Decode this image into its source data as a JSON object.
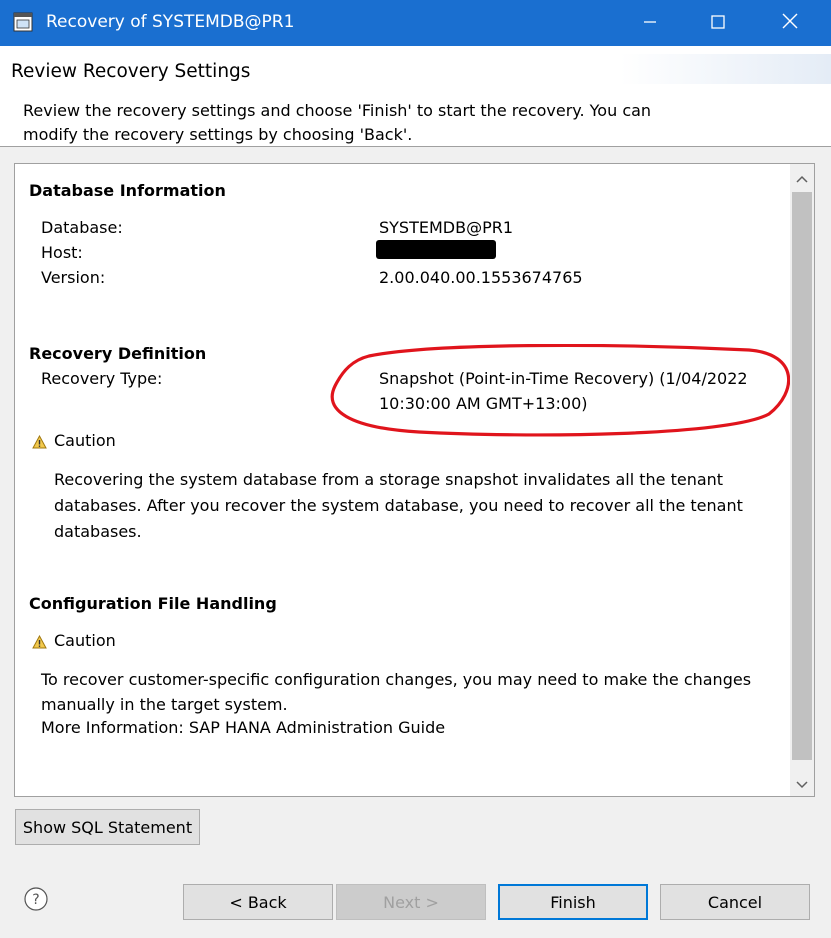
{
  "window": {
    "title": "Recovery of SYSTEMDB@PR1"
  },
  "header": {
    "title": "Review Recovery Settings",
    "description": "Review the recovery settings and choose 'Finish' to start the recovery. You can modify the recovery settings by choosing 'Back'."
  },
  "database_info": {
    "heading": "Database Information",
    "database_label": "Database:",
    "database_value": "SYSTEMDB@PR1",
    "host_label": "Host:",
    "host_value": "",
    "version_label": "Version:",
    "version_value": "2.00.040.00.1553674765"
  },
  "recovery_definition": {
    "heading": "Recovery Definition",
    "type_label": "Recovery Type:",
    "type_value_line1": "Snapshot (Point-in-Time Recovery) (1/04/2022",
    "type_value_line2": "10:30:00 AM GMT+13:00)",
    "caution_label": "Caution",
    "caution_text": "Recovering the system database from a storage snapshot invalidates all the tenant databases. After you recover the system database, you need to recover all the tenant databases."
  },
  "config_file_handling": {
    "heading": "Configuration File Handling",
    "caution_label": "Caution",
    "caution_text": "To recover customer-specific configuration changes, you may need to make the changes manually in the target system.",
    "more_info": "More Information: SAP HANA Administration Guide"
  },
  "buttons": {
    "show_sql": "Show SQL Statement",
    "back": "< Back",
    "next": "Next >",
    "finish": "Finish",
    "cancel": "Cancel"
  },
  "icons": {
    "app": "window-app-icon",
    "minimize": "minimize-icon",
    "maximize": "maximize-icon",
    "close": "close-icon",
    "warning": "warning-icon",
    "help": "help-icon"
  },
  "colors": {
    "titlebar": "#1a6fd0",
    "highlight_ellipse": "#e0141c",
    "default_button_border": "#0078d7"
  }
}
